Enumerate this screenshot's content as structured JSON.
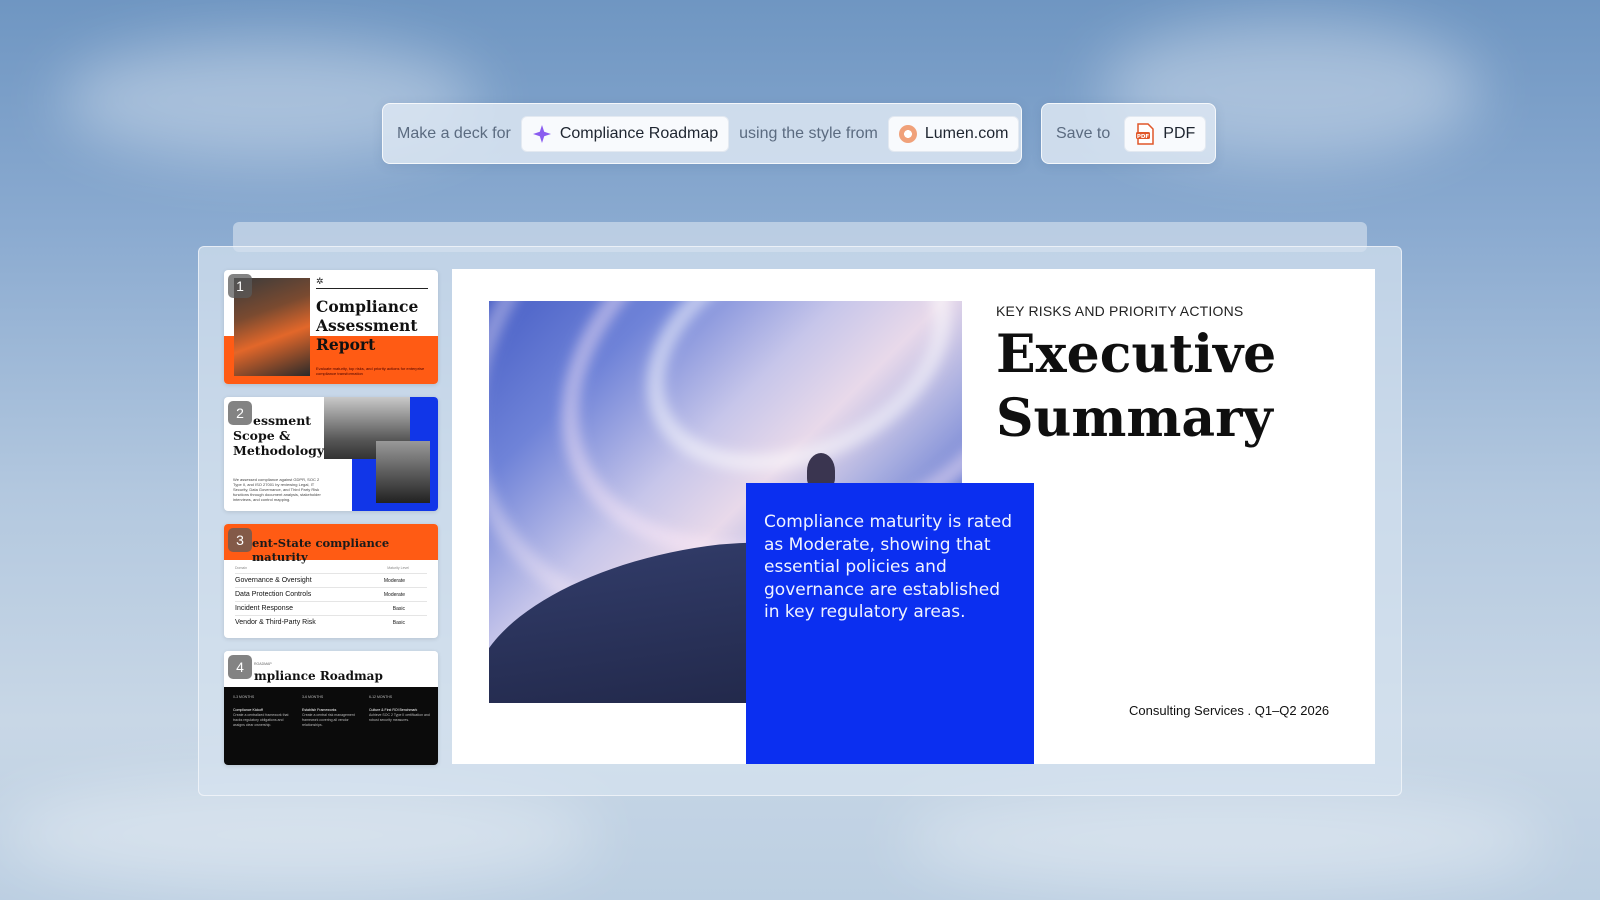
{
  "prompt": {
    "prefix": "Make a deck for",
    "topic": "Compliance Roadmap",
    "middle": "using the style from",
    "style_source": "Lumen.com",
    "save_label": "Save to",
    "save_target": "PDF"
  },
  "thumbnails": [
    {
      "number": "1",
      "title_lines": [
        "Compliance",
        "Assessment",
        "Report"
      ],
      "subtitle": "Evaluate maturity, top risks, and priority actions for enterprise compliance transformation"
    },
    {
      "number": "2",
      "title_lines": [
        "essment",
        "Scope &",
        "Methodology"
      ],
      "body": "We assessed compliance against GDPR, SOC 2 Type II, and ISO 27001 by reviewing Legal, IT Security, Data Governance, and Third Party Risk functions through document analysis, stakeholder interviews, and control mapping."
    },
    {
      "number": "3",
      "title": "ent-State compliance maturity",
      "col_headers": [
        "Domain",
        "Maturity Level"
      ],
      "rows": [
        {
          "domain": "Governance & Oversight",
          "level": "Moderate"
        },
        {
          "domain": "Data Protection Controls",
          "level": "Moderate"
        },
        {
          "domain": "Incident Response",
          "level": "Basic"
        },
        {
          "domain": "Vendor & Third-Party Risk",
          "level": "Basic"
        }
      ]
    },
    {
      "number": "4",
      "kicker": "ROADMAP",
      "title": "mpliance Roadmap",
      "columns": [
        {
          "period": "0-3 MONTHS",
          "heading": "Compliance Kickoff",
          "body": "Create a centralized framework that tracks regulatory obligations and assigns clear ownership."
        },
        {
          "period": "3-6 MONTHS",
          "heading": "Establish Frameworks",
          "body": "Create a central risk management framework covering all vendor relationships."
        },
        {
          "period": "6-12 MONTHS",
          "heading": "Culture & First ROI Benchmark",
          "body": "Achieve SOC 2 Type II certification and robust security measures."
        }
      ]
    }
  ],
  "slide": {
    "kicker": "KEY RISKS AND PRIORITY ACTIONS",
    "headline_1": "Executive",
    "headline_2": "Summary",
    "body": "Compliance maturity is rated as Moderate, showing that essential policies and governance are established in key regulatory areas.",
    "footer": "Consulting Services . Q1–Q2 2026",
    "accent_color": "#0b2ff0",
    "orange_color": "#ff5b14"
  }
}
